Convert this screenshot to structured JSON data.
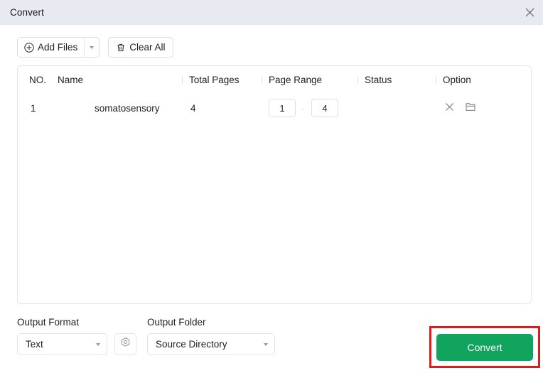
{
  "window": {
    "title": "Convert",
    "close_icon": "close-icon"
  },
  "toolbar": {
    "add_files_label": "Add Files",
    "add_files_icon": "circle-plus-icon",
    "add_files_caret_icon": "chevron-down-icon",
    "clear_all_label": "Clear All",
    "clear_all_icon": "trash-icon"
  },
  "file_table": {
    "columns": [
      "NO.",
      "Name",
      "Total Pages",
      "Page Range",
      "Status",
      "Option"
    ],
    "rows": [
      {
        "no": "1",
        "name": "somatosensory",
        "total_pages": "4",
        "page_range_from": "1",
        "page_range_dash": "-",
        "page_range_to": "4",
        "status": "",
        "option_remove_icon": "close-icon",
        "option_folder_icon": "folder-icon"
      }
    ]
  },
  "bottom": {
    "output_format_label": "Output Format",
    "output_format_value": "Text",
    "output_format_caret_icon": "chevron-down-icon",
    "settings_icon": "settings-icon",
    "output_folder_label": "Output Folder",
    "output_folder_value": "Source Directory",
    "output_folder_caret_icon": "chevron-down-icon",
    "convert_label": "Convert"
  },
  "colors": {
    "titlebar_bg": "#e8eaf1",
    "convert_green": "#10a45f",
    "highlight_red": "#e01b1b",
    "border_gray": "#e6e6e6"
  }
}
